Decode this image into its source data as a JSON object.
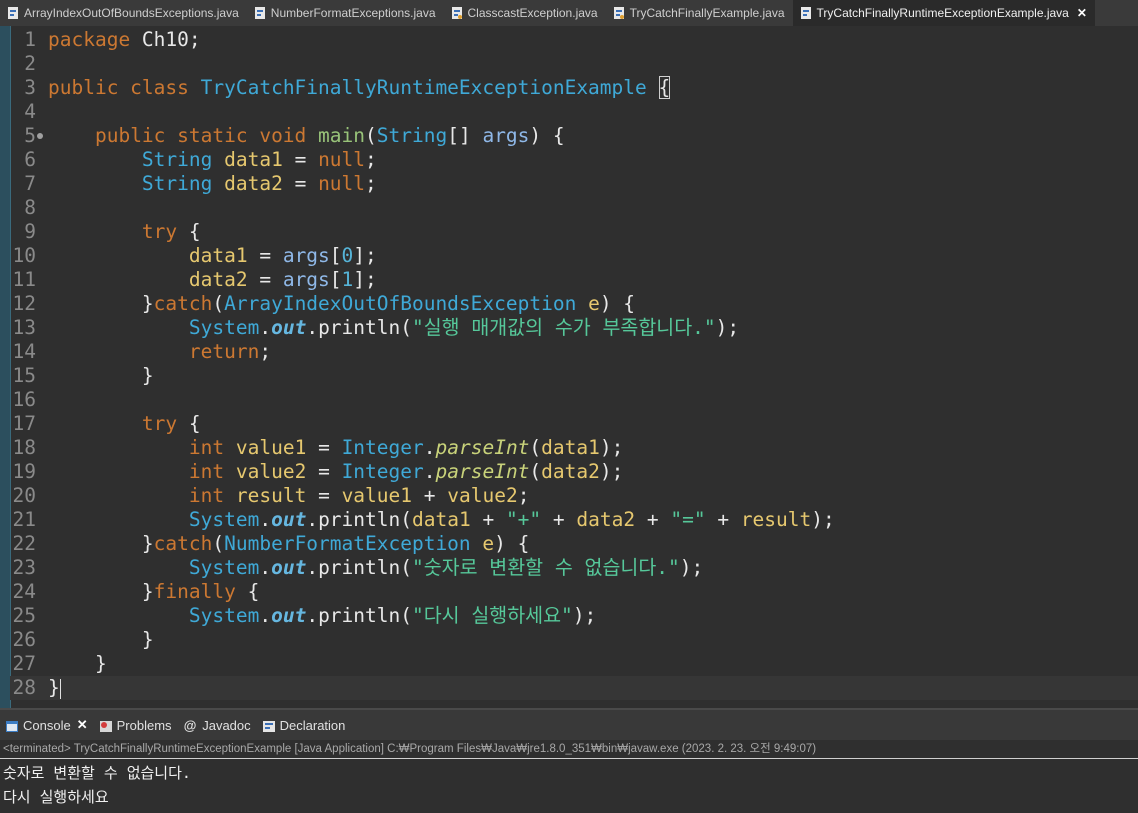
{
  "tabs": [
    {
      "label": "ArrayIndexOutOfBoundsExceptions.java",
      "active": false
    },
    {
      "label": "NumberFormatExceptions.java",
      "active": false
    },
    {
      "label": "ClasscastException.java",
      "active": false
    },
    {
      "label": "TryCatchFinallyExample.java",
      "active": false
    },
    {
      "label": "TryCatchFinallyRuntimeExceptionExample.java",
      "active": true
    }
  ],
  "editor": {
    "line_numbers": [
      "1",
      "2",
      "3",
      "4",
      "5",
      "6",
      "7",
      "8",
      "9",
      "10",
      "11",
      "12",
      "13",
      "14",
      "15",
      "16",
      "17",
      "18",
      "19",
      "20",
      "21",
      "22",
      "23",
      "24",
      "25",
      "26",
      "27",
      "28"
    ],
    "strings": {
      "msg13": "\"실행 매개값의 수가 부족합니다.\"",
      "plus": "\"+\"",
      "equals": "\"=\"",
      "msg23": "\"숫자로 변환할 수 없습니다.\"",
      "msg25": "\"다시 실행하세요\""
    }
  },
  "console": {
    "tabs": [
      "Console",
      "Problems",
      "Javadoc",
      "Declaration"
    ],
    "status": "<terminated> TryCatchFinallyRuntimeExceptionExample [Java Application] C:₩Program Files₩Java₩jre1.8.0_351₩bin₩javaw.exe (2023. 2. 23. 오전 9:49:07)",
    "output": [
      "숫자로 변환할 수 없습니다.",
      "다시 실행하세요"
    ]
  },
  "colors": {
    "keyword": "#cc7832",
    "type": "#3fa9d7",
    "string": "#56c89a",
    "variable": "#e6c86f"
  }
}
